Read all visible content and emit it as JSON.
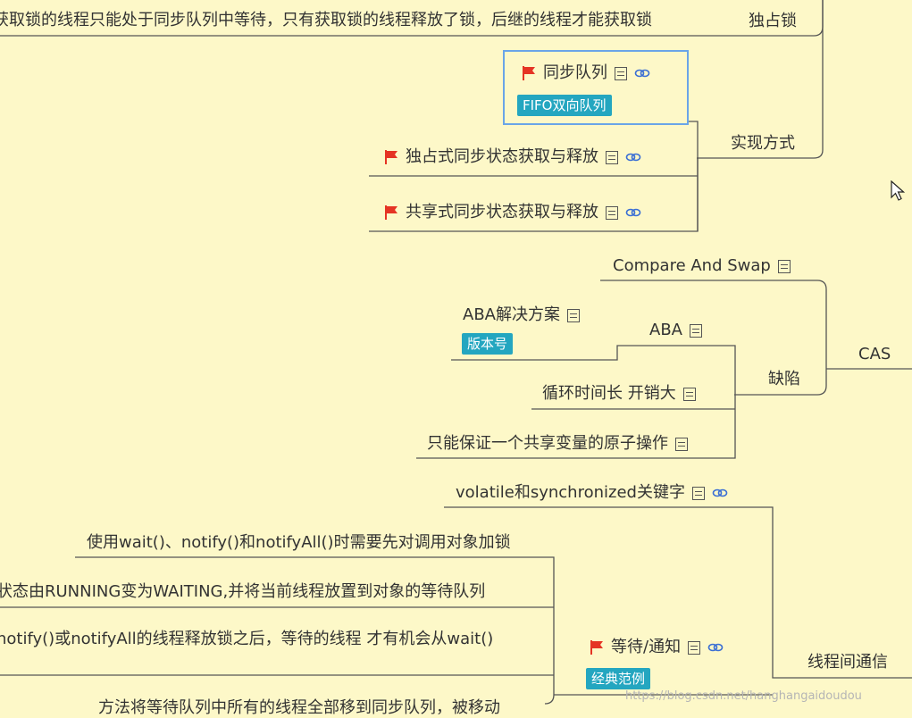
{
  "nodes": {
    "exclusive_lock": "独占锁",
    "exclusive_desc": "获取锁的线程只能处于同步队列中等待，只有获取锁的线程释放了锁，后继的线程才能获取锁",
    "implementation": "实现方式",
    "sync_queue": "同步队列",
    "fifo_tag": "FIFO双向队列",
    "exclusive_sync": "独占式同步状态获取与释放",
    "shared_sync": "共享式同步状态获取与释放",
    "compare_and_swap": "Compare And Swap",
    "cas": "CAS",
    "aba_solution": "ABA解决方案",
    "version_tag": "版本号",
    "aba": "ABA",
    "defects": "缺陷",
    "long_loop": "循环时间长 开销大",
    "single_var": "只能保证一个共享变量的原子操作",
    "volatile_sync": "volatile和synchronized关键字",
    "wait_notify_lock": "使用wait()、notify()和notifyAll()时需要先对调用对象加锁",
    "running_waiting": "状态由RUNNING变为WAITING,并将当前线程放置到对象的等待队列",
    "notify_release": "notify()或notifyAll的线程释放锁之后，等待的线程 才有机会从wait()",
    "wait_notify": "等待/通知",
    "classic_tag": "经典范例",
    "thread_comm": "线程间通信",
    "notify_all_partial": "方法将等待队列中所有的线程全部移到同步队列，被移动"
  },
  "watermark": "https://blog.csdn.net/hanghangaidoudou",
  "colors": {
    "background": "#fdf8c8",
    "line": "#555555",
    "tag": "#24a6c0",
    "flag": "#e53424",
    "link": "#3b6fd4",
    "selection": "#6aa5e8"
  }
}
